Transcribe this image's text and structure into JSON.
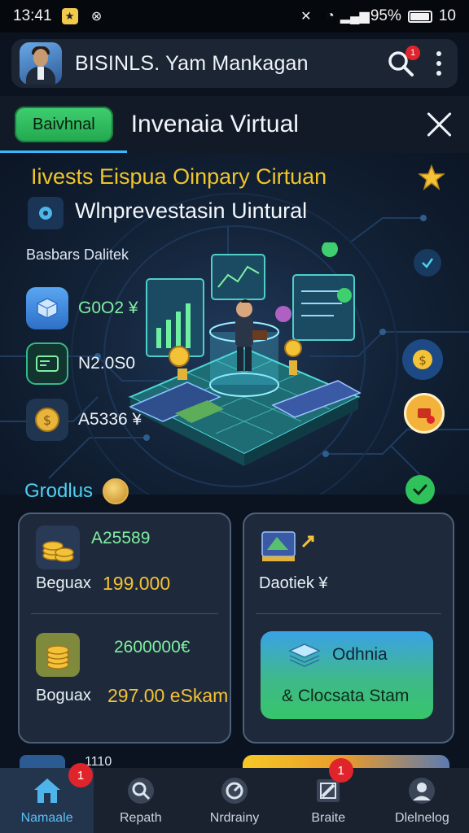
{
  "status_bar": {
    "time": "13:41",
    "battery_text": "95%",
    "extra": "10",
    "battery_level": 0.95
  },
  "header": {
    "title": "BISINLS. Yam Mankagan",
    "notification_count": "1"
  },
  "tabs": {
    "active_label": "Baivhnal",
    "title": "Invenaia Virtual"
  },
  "hero": {
    "title": "Iivests Eispua Oinpary Cirtuan",
    "subtitle": "Wlnprevestasin Uintural",
    "caption": "Basbars Dalitek",
    "stats": [
      {
        "icon": "cube-icon",
        "value": "G0O2 ¥"
      },
      {
        "icon": "wallet-icon",
        "value": "N2.0S0"
      },
      {
        "icon": "coins-icon",
        "value": "A5336 ¥"
      }
    ]
  },
  "section": {
    "title": "Grodlus"
  },
  "card_left": {
    "row1": {
      "amount": "A25589",
      "label": "Beguax",
      "value": "199.000"
    },
    "row2": {
      "amount": "2600000€",
      "label": "Boguax",
      "value": "297.00 eSkam"
    }
  },
  "card_right": {
    "label": "Daotiek ¥",
    "button_top": "Odhnia",
    "button_bottom": "& Clocsata Stam"
  },
  "peek": {
    "text": "1110"
  },
  "bottom_nav": {
    "items": [
      {
        "label": "Namaale",
        "badge": "1"
      },
      {
        "label": "Repath",
        "badge": ""
      },
      {
        "label": "Nrdrainy",
        "badge": ""
      },
      {
        "label": "Braite",
        "badge": "1"
      },
      {
        "label": "Dlelnelog",
        "badge": ""
      }
    ]
  },
  "colors": {
    "accent_green": "#2fc25b",
    "accent_blue": "#38b9ff",
    "gold": "#f4c236",
    "badge_red": "#e0242c"
  }
}
